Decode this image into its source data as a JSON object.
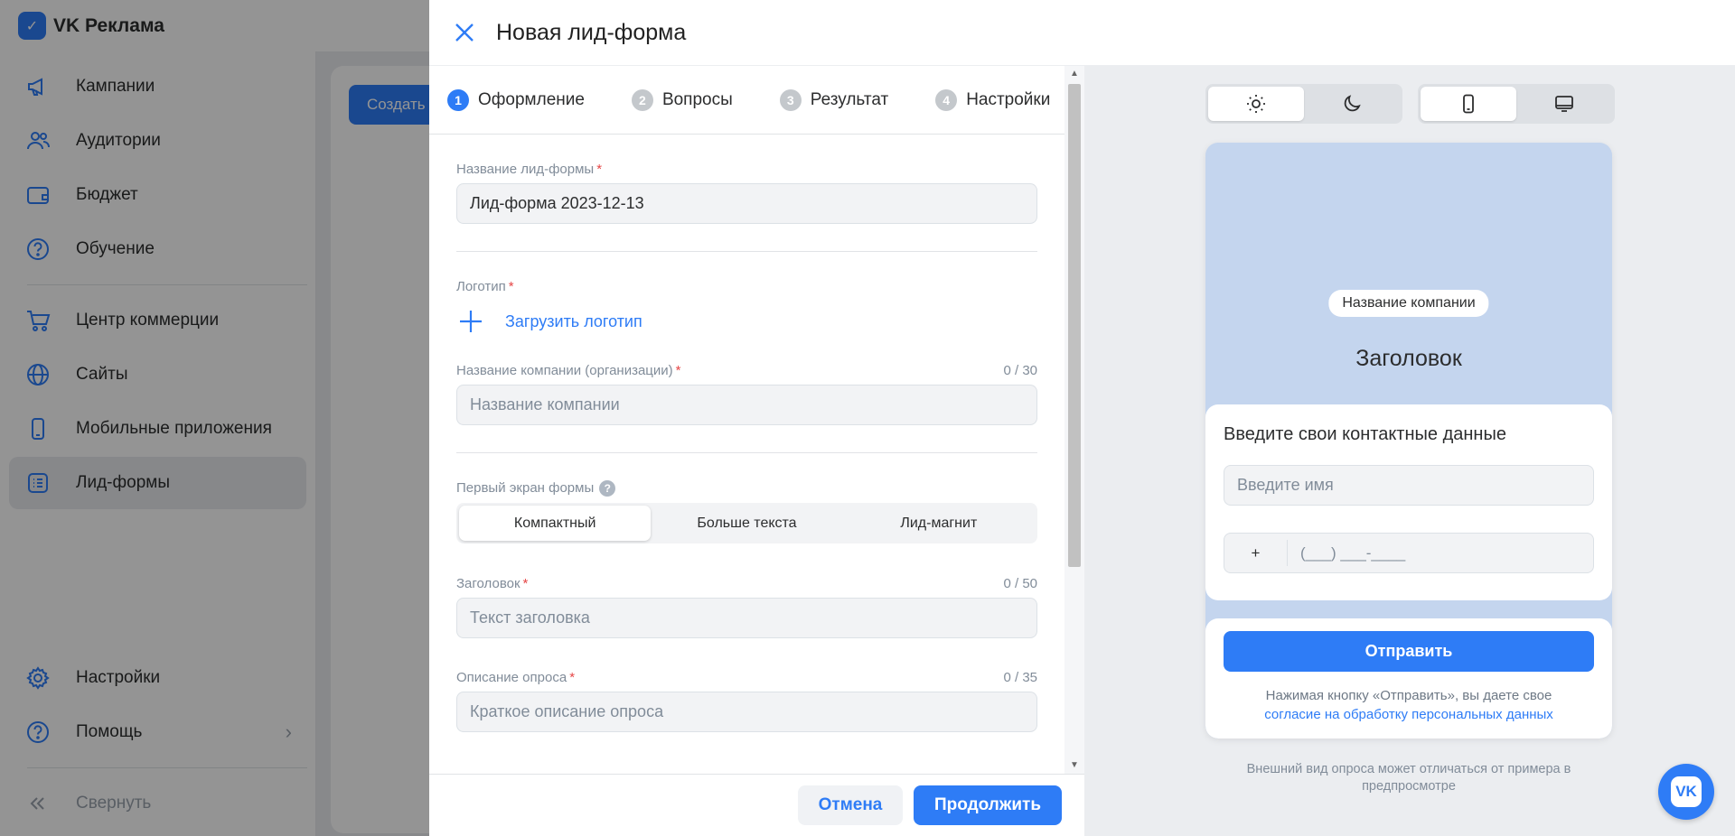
{
  "app": {
    "brand": "VK Реклама",
    "logo_glyph": "✓",
    "create_button": "Создать"
  },
  "sidebar": {
    "items": [
      {
        "label": "Кампании",
        "icon": "megaphone-icon"
      },
      {
        "label": "Аудитории",
        "icon": "users-icon"
      },
      {
        "label": "Бюджет",
        "icon": "wallet-icon"
      },
      {
        "label": "Обучение",
        "icon": "question-icon"
      },
      {
        "label": "Центр коммерции",
        "icon": "cart-icon"
      },
      {
        "label": "Сайты",
        "icon": "globe-icon"
      },
      {
        "label": "Мобильные приложения",
        "icon": "phone-icon"
      },
      {
        "label": "Лид-формы",
        "icon": "list-icon",
        "active": true
      }
    ],
    "bottom": [
      {
        "label": "Настройки",
        "icon": "gear-icon"
      },
      {
        "label": "Помощь",
        "icon": "question-icon"
      },
      {
        "label": "Свернуть",
        "icon": "collapse-icon"
      }
    ]
  },
  "modal": {
    "title": "Новая лид-форма",
    "steps": [
      {
        "num": "1",
        "label": "Оформление",
        "active": true
      },
      {
        "num": "2",
        "label": "Вопросы"
      },
      {
        "num": "3",
        "label": "Результат"
      },
      {
        "num": "4",
        "label": "Настройки"
      }
    ],
    "form": {
      "name_label": "Название лид-формы",
      "name_value": "Лид-форма 2023-12-13",
      "logo_label": "Логотип",
      "upload_label": "Загрузить логотип",
      "company_label": "Название компании (организации)",
      "company_counter": "0 / 30",
      "company_placeholder": "Название компании",
      "first_screen_label": "Первый экран формы",
      "first_screen_options": [
        "Компактный",
        "Больше текста",
        "Лид-магнит"
      ],
      "first_screen_selected": "Компактный",
      "headline_label": "Заголовок",
      "headline_counter": "0 / 50",
      "headline_placeholder": "Текст заголовка",
      "description_label": "Описание опроса",
      "description_counter": "0 / 35",
      "description_placeholder": "Краткое описание опроса",
      "required_mark": "*"
    },
    "footer": {
      "cancel": "Отмена",
      "continue": "Продолжить"
    }
  },
  "preview": {
    "theme_toggle": [
      "sun-icon",
      "moon-icon"
    ],
    "device_toggle": [
      "mobile-icon",
      "desktop-icon"
    ],
    "company_pill": "Название компании",
    "headline": "Заголовок",
    "contact_title": "Введите свои контактные данные",
    "name_placeholder": "Введите имя",
    "phone_code": "+",
    "phone_mask": "(___) ___-____",
    "submit": "Отправить",
    "consent_text": "Нажимая кнопку «Отправить», вы даете свое",
    "consent_link": "согласие на обработку персональных данных",
    "disclaimer": "Внешний вид опроса может отличаться от примера в предпросмотре"
  },
  "colors": {
    "accent": "#2e7cf6",
    "preview_bg": "#c4d5ee",
    "required": "#e64646"
  },
  "fab": {
    "label": "VK"
  }
}
